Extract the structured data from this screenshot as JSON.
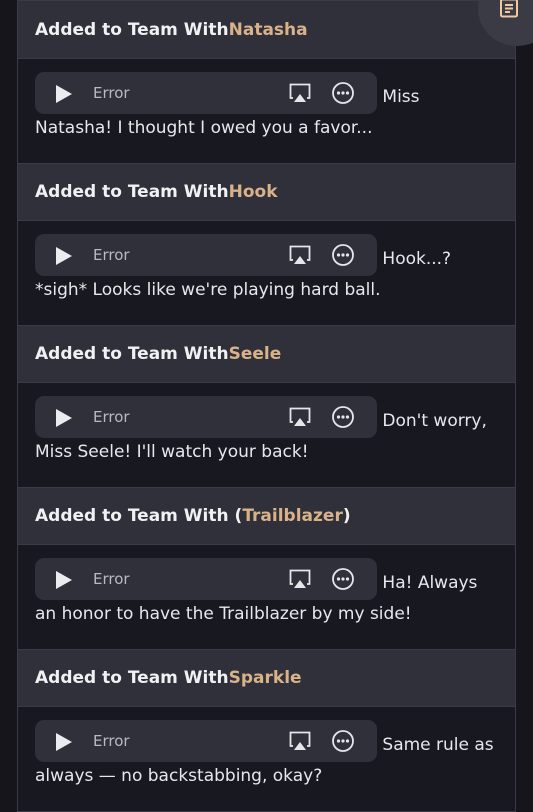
{
  "sections": [
    {
      "prefix": "Added to Team With ",
      "name": "Natasha",
      "player_status": "Error",
      "text": "Miss Natasha! I thought I owed you a favor..."
    },
    {
      "prefix": "Added to Team With ",
      "name": "Hook",
      "player_status": "Error",
      "text": "Hook...? *sigh* Looks like we're playing hard ball."
    },
    {
      "prefix": "Added to Team With ",
      "name": "Seele",
      "player_status": "Error",
      "text": "Don't worry, Miss Seele! I'll watch your back!"
    },
    {
      "prefix": "Added to Team With (",
      "name": "Trailblazer",
      "suffix": ")",
      "player_status": "Error",
      "text": "Ha! Always an honor to have the Trailblazer by my side!"
    },
    {
      "prefix": "Added to Team With ",
      "name": "Sparkle",
      "player_status": "Error",
      "text": "Same rule as always — no backstabbing, okay?"
    }
  ],
  "icons": {
    "play": "play-icon",
    "airplay": "airplay-icon",
    "more": "more-options-icon",
    "fab": "document-icon"
  },
  "colors": {
    "header_bg": "#2f3039",
    "body_bg": "#171820",
    "name_accent": "#d9b28a",
    "player_bg": "#2f3039"
  }
}
